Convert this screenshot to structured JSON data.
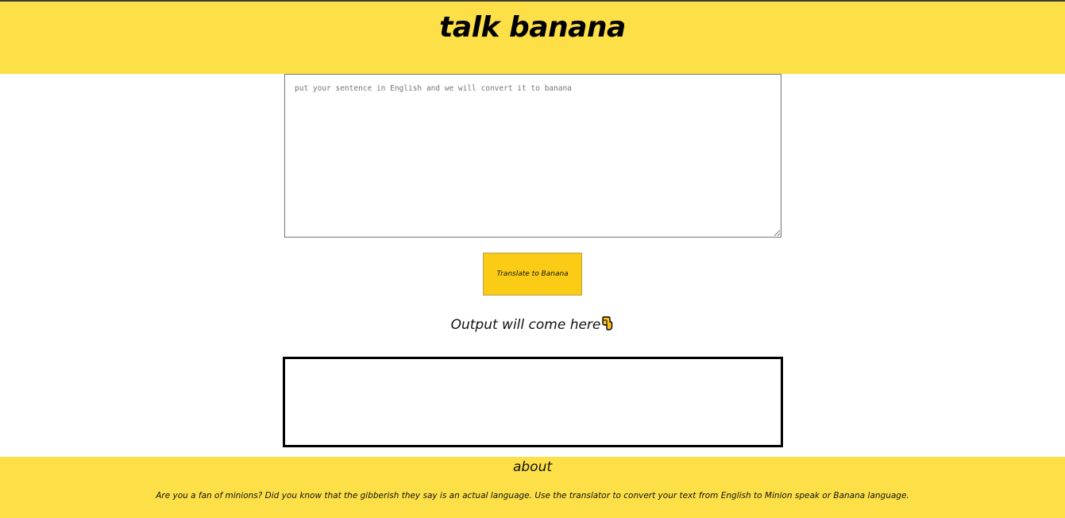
{
  "header": {
    "title": "talk banana",
    "background_color": "#fde047"
  },
  "input": {
    "placeholder": "put your sentence in English and we will convert it to banana",
    "value": ""
  },
  "translate_button": {
    "label": "Translate to Banana",
    "color": "#facc15"
  },
  "output": {
    "heading": "Output will come here",
    "heading_icon": "pointing-down-hand-icon",
    "text": ""
  },
  "footer": {
    "title": "about",
    "description": "Are you a fan of minions? Did you know that the gibberish they say is an actual language. Use the translator to convert your text from English to Minion speak or Banana language.",
    "background_color": "#fde047"
  }
}
